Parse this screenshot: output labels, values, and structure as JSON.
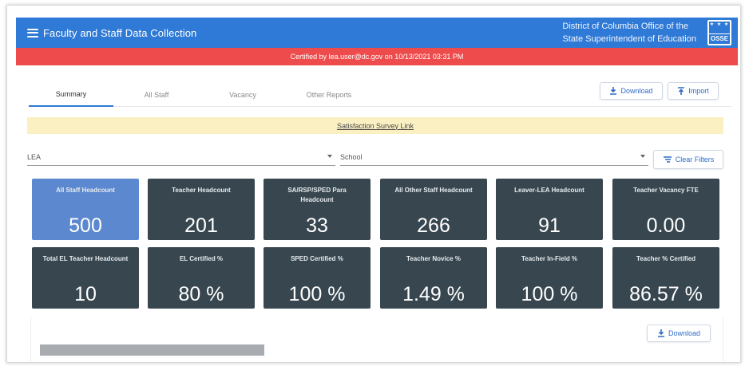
{
  "header": {
    "title": "Faculty and Staff Data Collection",
    "org_line1": "District of Columbia Office of the",
    "org_line2": "State Superintendent of Education",
    "logo_text": "OSSE",
    "logo_stars": "★ ★ ★"
  },
  "certification": {
    "text": "Certified by lea.user@dc.gov on 10/13/2021 03:31 PM"
  },
  "tabs": [
    {
      "label": "Summary",
      "active": true
    },
    {
      "label": "All Staff",
      "active": false
    },
    {
      "label": "Vacancy",
      "active": false
    },
    {
      "label": "Other Reports",
      "active": false
    }
  ],
  "actions": {
    "download_label": "Download",
    "import_label": "Import",
    "clear_filters_label": "Clear Filters",
    "bottom_download_label": "Download"
  },
  "survey": {
    "link_text": "Satisfaction Survey Link"
  },
  "filters": {
    "lea_label": "LEA",
    "school_label": "School"
  },
  "cards": [
    {
      "label": "All Staff Headcount",
      "value": "500",
      "highlight": true
    },
    {
      "label": "Teacher Headcount",
      "value": "201",
      "highlight": false
    },
    {
      "label": "SA/RSP/SPED Para Headcount",
      "value": "33",
      "highlight": false
    },
    {
      "label": "All Other Staff Headcount",
      "value": "266",
      "highlight": false
    },
    {
      "label": "Leaver-LEA Headcount",
      "value": "91",
      "highlight": false
    },
    {
      "label": "Teacher Vacancy FTE",
      "value": "0.00",
      "highlight": false
    },
    {
      "label": "Total EL Teacher Headcount",
      "value": "10",
      "highlight": false
    },
    {
      "label": "EL Certified %",
      "value": "80 %",
      "highlight": false
    },
    {
      "label": "SPED Certified %",
      "value": "100 %",
      "highlight": false
    },
    {
      "label": "Teacher Novice %",
      "value": "1.49 %",
      "highlight": false
    },
    {
      "label": "Teacher In-Field %",
      "value": "100 %",
      "highlight": false
    },
    {
      "label": "Teacher % Certified",
      "value": "86.57 %",
      "highlight": false
    }
  ],
  "colors": {
    "header_blue": "#2f7ad6",
    "banner_red": "#ee4c4c",
    "card_dark": "#37464f",
    "card_highlight": "#5b88cf",
    "survey_bg": "#fbf0c2"
  },
  "icons": {
    "menu": "menu-icon",
    "download": "download-icon",
    "import": "upload-icon",
    "clear_filters": "filter-clear-icon",
    "dropdown": "chevron-down-icon"
  }
}
